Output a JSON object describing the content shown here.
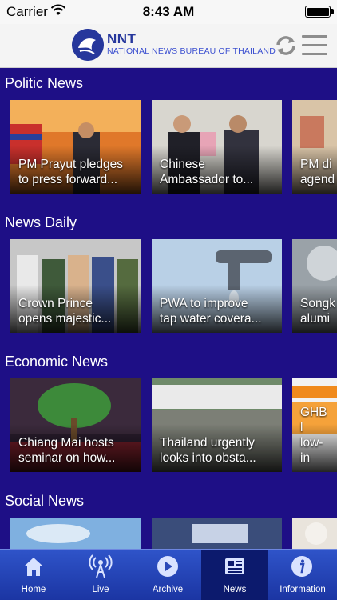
{
  "status_bar": {
    "carrier": "Carrier",
    "time": "8:43 AM"
  },
  "header": {
    "logo_title": "NNT",
    "logo_subtitle": "NATIONAL NEWS BUREAU OF THAILAND"
  },
  "sections": [
    {
      "title": "Politic News",
      "cards": [
        "PM Prayut pledges\nto press forward...",
        "Chinese\nAmbassador to...",
        "PM di\nagend"
      ]
    },
    {
      "title": "News Daily",
      "cards": [
        "Crown Prince\nopens majestic...",
        "PWA to improve\ntap water covera...",
        "Songk\nalumi"
      ]
    },
    {
      "title": "Economic News",
      "cards": [
        "Chiang Mai hosts\nseminar on how...",
        "Thailand urgently\nlooks into obsta...",
        "GHB l\nlow-in"
      ]
    },
    {
      "title": "Social News",
      "cards": [
        "",
        "",
        ""
      ]
    }
  ],
  "tabs": [
    {
      "label": "Home",
      "icon": "home-icon",
      "active": false
    },
    {
      "label": "Live",
      "icon": "broadcast-icon",
      "active": false
    },
    {
      "label": "Archive",
      "icon": "play-icon",
      "active": false
    },
    {
      "label": "News",
      "icon": "newspaper-icon",
      "active": true
    },
    {
      "label": "Information",
      "icon": "info-icon",
      "active": false
    }
  ],
  "colors": {
    "background": "#1e0f86",
    "tabbar": "#2341b5",
    "brand": "#26379c"
  }
}
